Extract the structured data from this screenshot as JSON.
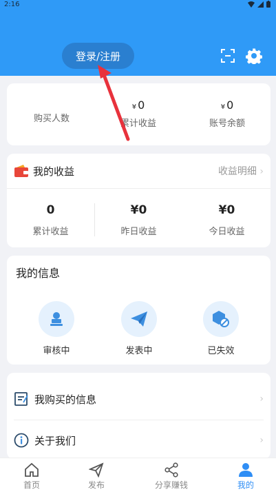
{
  "status_bar": {
    "time": "2:16"
  },
  "header": {
    "login_label": "登录/注册"
  },
  "stats": [
    {
      "value": "",
      "label": "购买人数"
    },
    {
      "currency": "¥",
      "value": "0",
      "label": "累计收益"
    },
    {
      "currency": "¥",
      "value": "0",
      "label": "账号余额"
    }
  ],
  "income": {
    "title": "我的收益",
    "detail_link": "收益明细",
    "items": [
      {
        "value": "0",
        "label": "累计收益"
      },
      {
        "value": "¥0",
        "label": "昨日收益"
      },
      {
        "value": "¥0",
        "label": "今日收益"
      }
    ]
  },
  "my_info": {
    "title": "我的信息",
    "items": [
      {
        "label": "审核中",
        "icon": "reviewing-icon"
      },
      {
        "label": "发表中",
        "icon": "publishing-icon"
      },
      {
        "label": "已失效",
        "icon": "expired-icon"
      }
    ]
  },
  "menu": [
    {
      "label": "我购买的信息",
      "icon": "purchased-info-icon"
    },
    {
      "label": "关于我们",
      "icon": "about-icon"
    }
  ],
  "tabs": [
    {
      "label": "首页",
      "icon": "home-icon"
    },
    {
      "label": "发布",
      "icon": "publish-icon"
    },
    {
      "label": "分享赚钱",
      "icon": "share-icon"
    },
    {
      "label": "我的",
      "icon": "profile-icon",
      "active": true
    }
  ],
  "colors": {
    "primary": "#2f9af7",
    "accent": "#2f8ef5",
    "annotation_arrow": "#e8323c"
  }
}
